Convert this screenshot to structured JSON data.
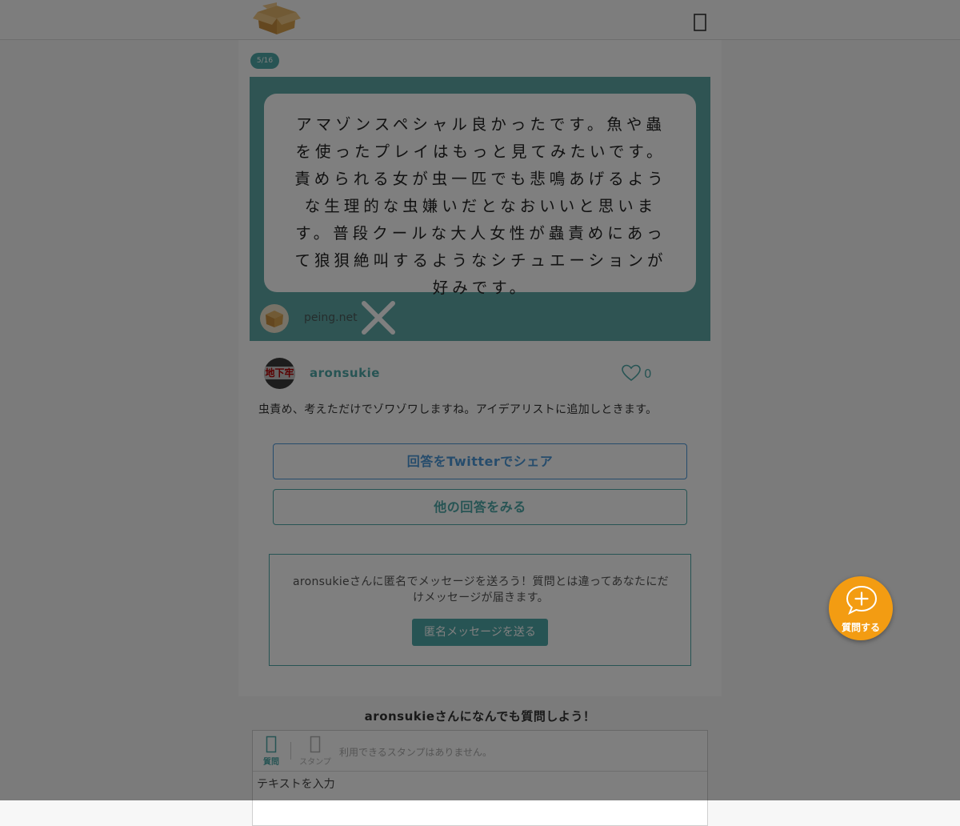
{
  "header": {
    "logo_icon": "cardboard-box-icon",
    "menu_icon": "hamburger-menu-icon"
  },
  "question": {
    "page_indicator": "5/16",
    "text": "アマゾンスペシャル良かったです。魚や蟲を使ったプレイはもっと見てみたいです。責められる女が虫一匹でも悲鳴あげるような生理的な虫嫌いだとなおいいと思います。普段クールな大人女性が蟲責めにあって狼狽絶叫するようなシチュエーションが好みです。",
    "site": "peing.net",
    "close_icon": "close-x-icon",
    "card_color": "#5fa8a6"
  },
  "answer": {
    "avatar_text": "地下牢",
    "username": "aronsukie",
    "like_count": "0",
    "text": "虫責め、考えただけでゾワゾワしますね。アイデアリストに追加しときます。"
  },
  "buttons": {
    "share": "回答をTwitterでシェア",
    "other": "他の回答をみる"
  },
  "message": {
    "text": "aronsukieさんに匿名でメッセージを送ろう！質問とは違ってあなたにだけメッセージが届きます。",
    "button": "匿名メッセージを送る"
  },
  "ask": {
    "heading": "aronsukieさんになんでも質問しよう！",
    "tab_question": "質問",
    "tab_stamp": "スタンプ",
    "stamp_note": "利用できるスタンプはありません。",
    "placeholder": "テキストを入力"
  },
  "fab": {
    "label": "質問する",
    "icon": "chat-plus-icon",
    "color": "#f39c12"
  },
  "colors": {
    "accent": "#4fa9a8",
    "share_blue": "#4c98d8"
  }
}
